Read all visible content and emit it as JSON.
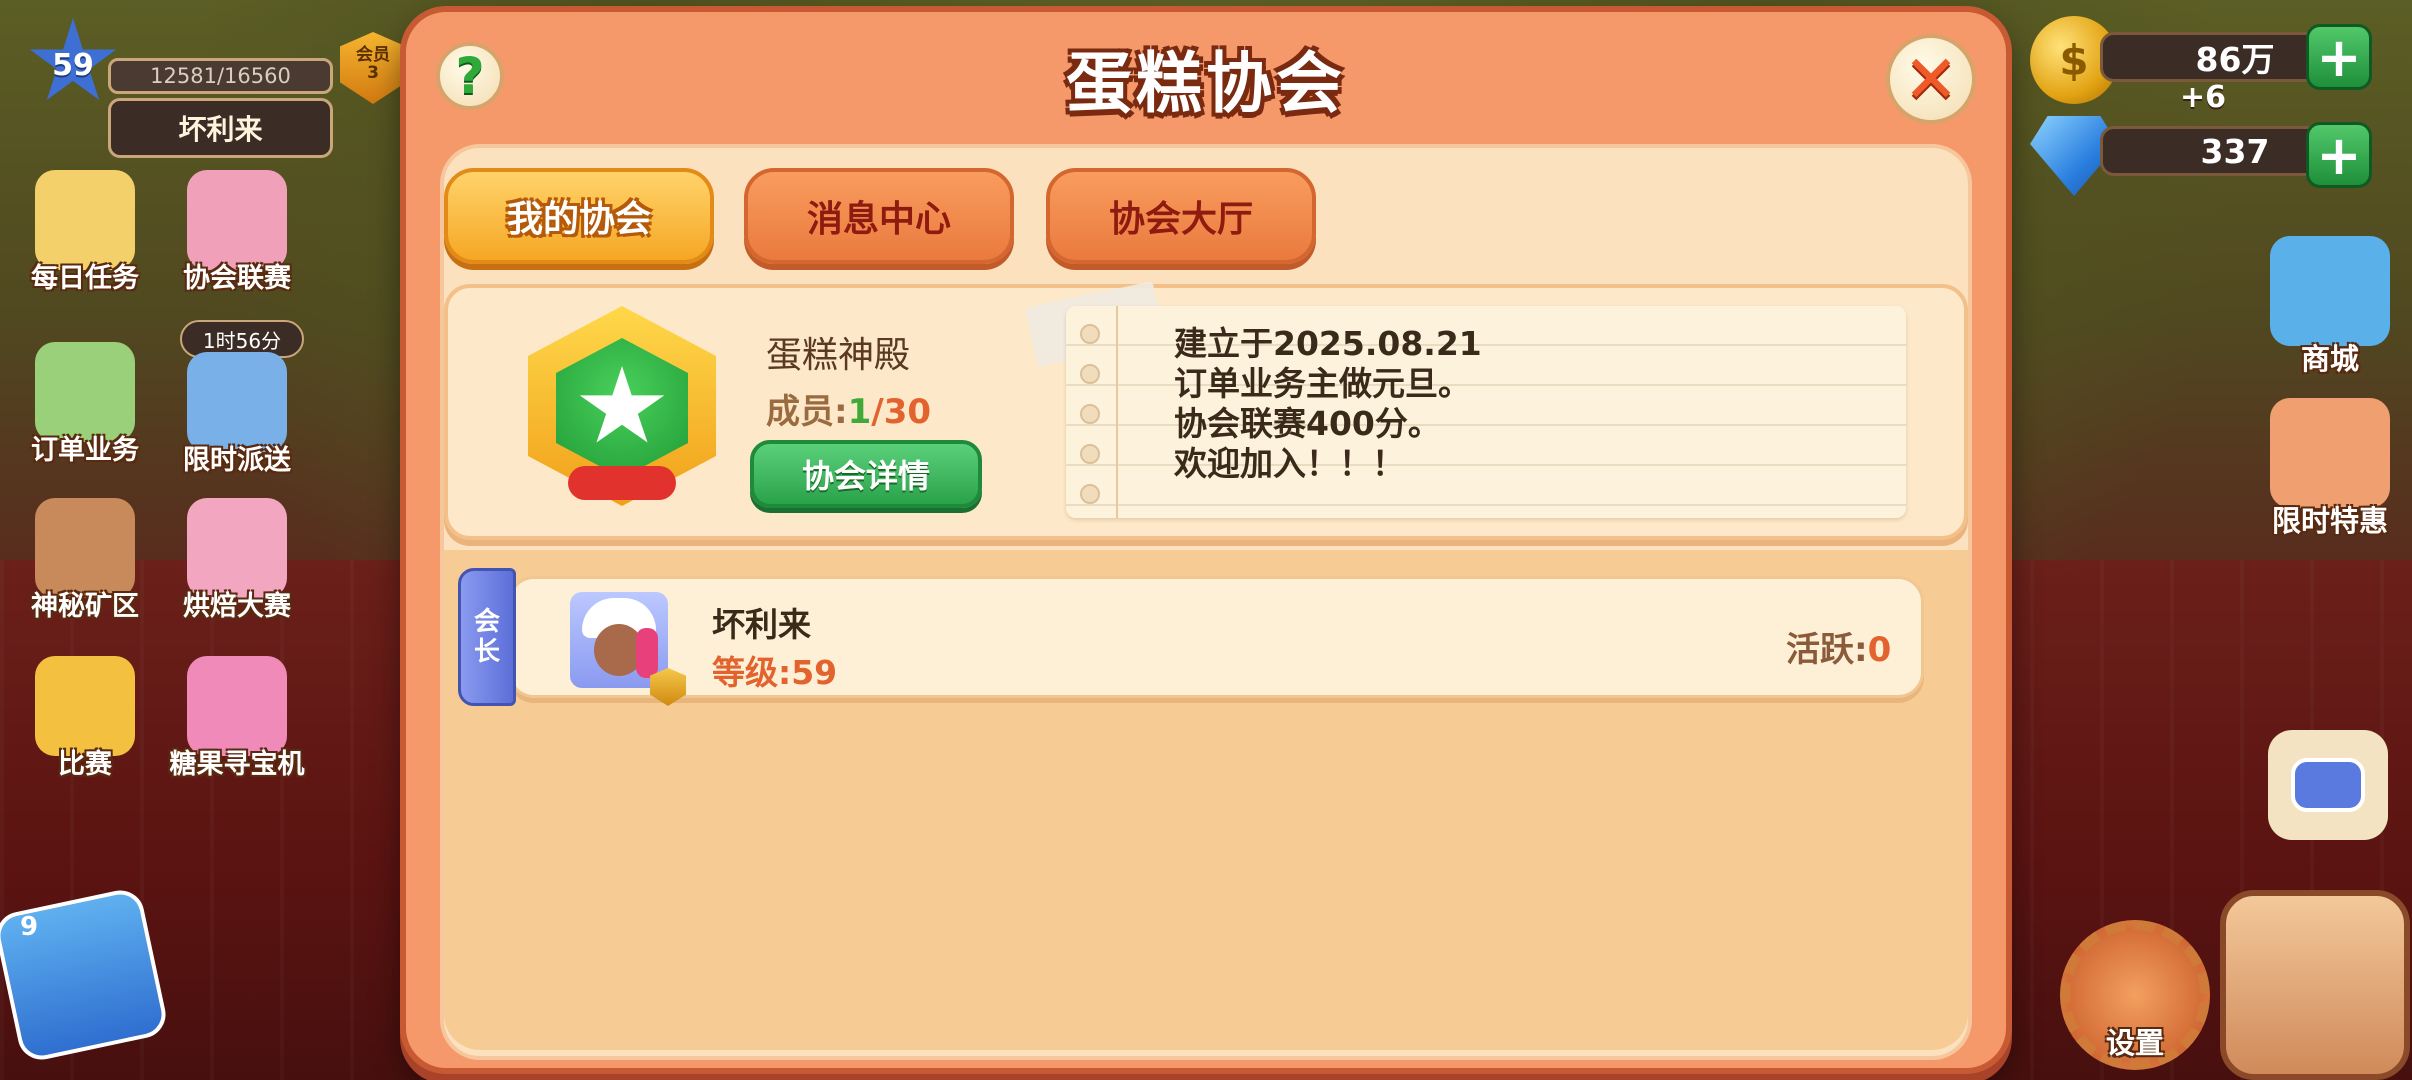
{
  "player": {
    "level": "59",
    "xp": "12581/16560",
    "name": "坏利来",
    "vip_label": "会员",
    "vip_level": "3"
  },
  "left_menu": [
    {
      "label": "每日任务"
    },
    {
      "label": "协会联赛",
      "timer": "1时56分"
    },
    {
      "label": "订单业务"
    },
    {
      "label": "限时派送"
    },
    {
      "label": "神秘矿区"
    },
    {
      "label": "烘焙大赛"
    },
    {
      "label": "比赛"
    },
    {
      "label": "糖果寻宝机"
    }
  ],
  "calendar_badge": "9",
  "resources": {
    "coins": "86万",
    "coin_bonus": "+6",
    "gems": "337",
    "coin_symbol": "$",
    "plus": "+"
  },
  "right_menu": [
    {
      "label": "商城"
    },
    {
      "label": "限时特惠"
    }
  ],
  "settings_label": "设置",
  "dialog": {
    "title": "蛋糕协会",
    "help_symbol": "?",
    "close_symbol": "✕",
    "tabs": [
      {
        "label": "我的协会",
        "active": true
      },
      {
        "label": "消息中心",
        "active": false
      },
      {
        "label": "协会大厅",
        "active": false
      }
    ],
    "guild": {
      "name": "蛋糕神殿",
      "members_label": "成员:",
      "members_current": "1",
      "members_sep": "/",
      "members_max": "30",
      "details_button": "协会详情",
      "notice_lines": [
        "建立于2025.08.21",
        "订单业务主做元旦。",
        "协会联赛400分。",
        "欢迎加入！！！"
      ]
    },
    "members": [
      {
        "role": "会长",
        "name": "坏利来",
        "level_label": "等级:",
        "level": "59",
        "activity_label": "活跃:",
        "activity": "0"
      }
    ]
  },
  "colors": {
    "dialog_bg": "#f5996a",
    "tab_active": "#f6a724",
    "tab_inactive": "#ea7a3e",
    "accent_green": "#2aa24a",
    "highlight_orange": "#e2632e"
  }
}
